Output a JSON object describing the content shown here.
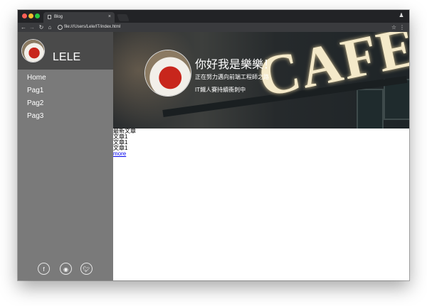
{
  "browser": {
    "tab_title": "Blog",
    "tab_close": "×",
    "url": "file:///Users/Lele/IT/index.html"
  },
  "sidebar": {
    "name": "LELE",
    "menu": [
      {
        "label": "Home"
      },
      {
        "label": "Pag1"
      },
      {
        "label": "Pag2"
      },
      {
        "label": "Pag3"
      }
    ],
    "social": [
      "facebook-icon",
      "github-icon",
      "twitter-icon"
    ]
  },
  "hero": {
    "title": "你好我是樂樂！",
    "line1": "正在努力邁向前端工程師之路",
    "line2": "IT鐵人賽持續衝刺中",
    "sign_text": "CAFE"
  },
  "content": {
    "heading": "最新文章",
    "articles": [
      "文章1",
      "文章1",
      "文章1"
    ],
    "more_link": "more"
  }
}
